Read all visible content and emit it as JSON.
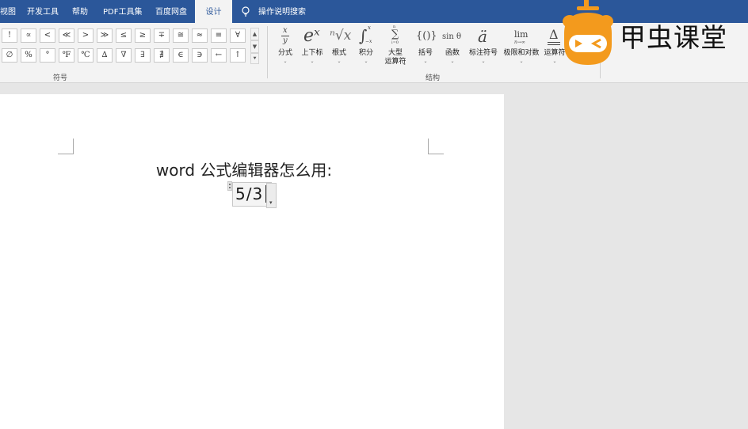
{
  "tabs": {
    "view": "视图",
    "developer": "开发工具",
    "help": "帮助",
    "pdf_tools": "PDF工具集",
    "baidu_netdisk": "百度网盘",
    "design": "设计",
    "tell_me": "操作说明搜索"
  },
  "symbols": {
    "row1": [
      "!",
      "∝",
      "<",
      "≪",
      ">",
      "≫",
      "≤",
      "≥",
      "∓",
      "≅",
      "≈",
      "≡",
      "∀"
    ],
    "row2": [
      "∅",
      "%",
      "°",
      "℉",
      "℃",
      "∆",
      "∇",
      "∃",
      "∄",
      "∈",
      "∋",
      "←",
      "↑"
    ],
    "group_label": "符号"
  },
  "structures": {
    "fraction": {
      "icon": "x/y",
      "label": "分式"
    },
    "script": {
      "icon": "eˣ",
      "label": "上下标"
    },
    "radical": {
      "icon": "ⁿ√x",
      "label": "根式"
    },
    "integral": {
      "icon": "∫",
      "label": "积分"
    },
    "large_operator": {
      "icon": "∑",
      "label1": "大型",
      "label2": "运算符"
    },
    "bracket": {
      "icon": "{()}",
      "label": "括号"
    },
    "function": {
      "icon": "sin θ",
      "label": "函数"
    },
    "accent": {
      "icon": "ä",
      "label": "标注符号"
    },
    "limit_log": {
      "icon": "lim",
      "sub": "n→∞",
      "label": "极限和对数"
    },
    "operator": {
      "icon": "Δ",
      "label": "运算符"
    },
    "group_label": "结构"
  },
  "document": {
    "line1": "word 公式编辑器怎么用:",
    "equation": "5/3"
  },
  "watermark": {
    "brand": "甲虫课堂"
  },
  "colors": {
    "ribbon_blue": "#2b579a",
    "mascot_orange": "#f39a1d"
  }
}
